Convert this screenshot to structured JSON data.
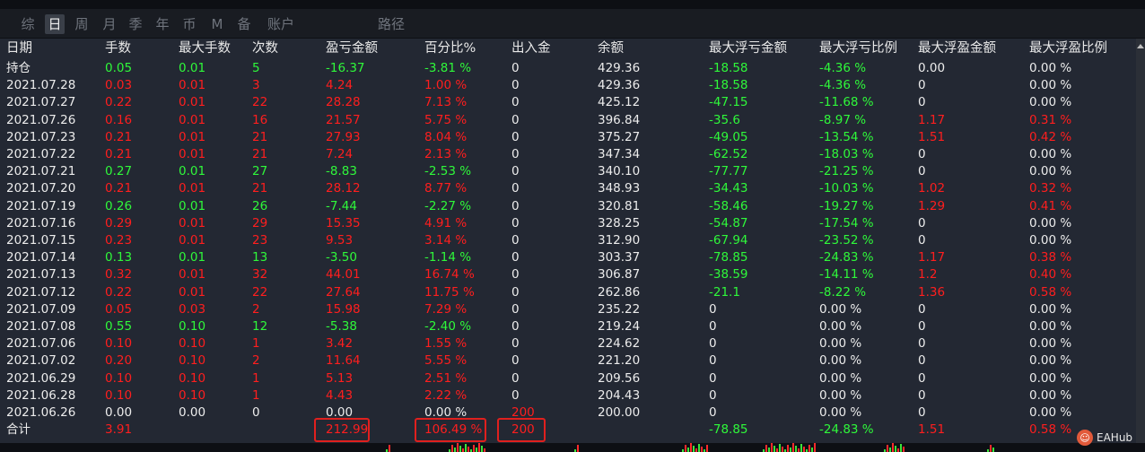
{
  "tabs": [
    {
      "label": "综",
      "active": false
    },
    {
      "label": "日",
      "active": true
    },
    {
      "label": "周",
      "active": false
    },
    {
      "label": "月",
      "active": false
    },
    {
      "label": "季",
      "active": false
    },
    {
      "label": "年",
      "active": false
    },
    {
      "label": "币",
      "active": false
    },
    {
      "label": "M",
      "active": false
    },
    {
      "label": "备",
      "active": false
    },
    {
      "label": "账户",
      "active": false
    },
    {
      "label": "路径",
      "active": false
    }
  ],
  "columns": [
    "日期",
    "手数",
    "最大手数",
    "次数",
    "盈亏金额",
    "百分比%",
    "出入金",
    "余额",
    "最大浮亏金额",
    "最大浮亏比例",
    "最大浮盈金额",
    "最大浮盈比例"
  ],
  "rows": [
    [
      "持仓",
      "0.05",
      "0.01",
      "5",
      "-16.37",
      "-3.81 %",
      "0",
      "429.36",
      "-18.58",
      "-4.36 %",
      "0.00",
      "0.00 %"
    ],
    [
      "2021.07.28",
      "0.03",
      "0.01",
      "3",
      "4.24",
      "1.00 %",
      "0",
      "429.36",
      "-18.58",
      "-4.36 %",
      "0",
      "0.00 %"
    ],
    [
      "2021.07.27",
      "0.22",
      "0.01",
      "22",
      "28.28",
      "7.13 %",
      "0",
      "425.12",
      "-47.15",
      "-11.68 %",
      "0",
      "0.00 %"
    ],
    [
      "2021.07.26",
      "0.16",
      "0.01",
      "16",
      "21.57",
      "5.75 %",
      "0",
      "396.84",
      "-35.6",
      "-8.97 %",
      "1.17",
      "0.31 %"
    ],
    [
      "2021.07.23",
      "0.21",
      "0.01",
      "21",
      "27.93",
      "8.04 %",
      "0",
      "375.27",
      "-49.05",
      "-13.54 %",
      "1.51",
      "0.42 %"
    ],
    [
      "2021.07.22",
      "0.21",
      "0.01",
      "21",
      "7.24",
      "2.13 %",
      "0",
      "347.34",
      "-62.52",
      "-18.03 %",
      "0",
      "0.00 %"
    ],
    [
      "2021.07.21",
      "0.27",
      "0.01",
      "27",
      "-8.83",
      "-2.53 %",
      "0",
      "340.10",
      "-77.77",
      "-21.25 %",
      "0",
      "0.00 %"
    ],
    [
      "2021.07.20",
      "0.21",
      "0.01",
      "21",
      "28.12",
      "8.77 %",
      "0",
      "348.93",
      "-34.43",
      "-10.03 %",
      "1.02",
      "0.32 %"
    ],
    [
      "2021.07.19",
      "0.26",
      "0.01",
      "26",
      "-7.44",
      "-2.27 %",
      "0",
      "320.81",
      "-58.46",
      "-19.27 %",
      "1.29",
      "0.41 %"
    ],
    [
      "2021.07.16",
      "0.29",
      "0.01",
      "29",
      "15.35",
      "4.91 %",
      "0",
      "328.25",
      "-54.87",
      "-17.54 %",
      "0",
      "0.00 %"
    ],
    [
      "2021.07.15",
      "0.23",
      "0.01",
      "23",
      "9.53",
      "3.14 %",
      "0",
      "312.90",
      "-67.94",
      "-23.52 %",
      "0",
      "0.00 %"
    ],
    [
      "2021.07.14",
      "0.13",
      "0.01",
      "13",
      "-3.50",
      "-1.14 %",
      "0",
      "303.37",
      "-78.85",
      "-24.83 %",
      "1.17",
      "0.38 %"
    ],
    [
      "2021.07.13",
      "0.32",
      "0.01",
      "32",
      "44.01",
      "16.74 %",
      "0",
      "306.87",
      "-38.59",
      "-14.11 %",
      "1.2",
      "0.40 %"
    ],
    [
      "2021.07.12",
      "0.22",
      "0.01",
      "22",
      "27.64",
      "11.75 %",
      "0",
      "262.86",
      "-21.1",
      "-8.22 %",
      "1.36",
      "0.58 %"
    ],
    [
      "2021.07.09",
      "0.05",
      "0.03",
      "2",
      "15.98",
      "7.29 %",
      "0",
      "235.22",
      "0",
      "0.00 %",
      "0",
      "0.00 %"
    ],
    [
      "2021.07.08",
      "0.55",
      "0.10",
      "12",
      "-5.38",
      "-2.40 %",
      "0",
      "219.24",
      "0",
      "0.00 %",
      "0",
      "0.00 %"
    ],
    [
      "2021.07.06",
      "0.10",
      "0.10",
      "1",
      "3.42",
      "1.55 %",
      "0",
      "224.62",
      "0",
      "0.00 %",
      "0",
      "0.00 %"
    ],
    [
      "2021.07.02",
      "0.20",
      "0.10",
      "2",
      "11.64",
      "5.55 %",
      "0",
      "221.20",
      "0",
      "0.00 %",
      "0",
      "0.00 %"
    ],
    [
      "2021.06.29",
      "0.10",
      "0.10",
      "1",
      "5.13",
      "2.51 %",
      "0",
      "209.56",
      "0",
      "0.00 %",
      "0",
      "0.00 %"
    ],
    [
      "2021.06.28",
      "0.10",
      "0.10",
      "1",
      "4.43",
      "2.22 %",
      "0",
      "204.43",
      "0",
      "0.00 %",
      "0",
      "0.00 %"
    ],
    [
      "2021.06.26",
      "0.00",
      "0.00",
      "0",
      "0.00",
      "0.00 %",
      "200",
      "200.00",
      "0",
      "0.00 %",
      "0",
      "0.00 %"
    ]
  ],
  "total": [
    "合计",
    "3.91",
    "",
    "",
    "212.99",
    "106.49 %",
    "200",
    "",
    "-78.85",
    "-24.83 %",
    "1.51",
    "0.58 %"
  ],
  "watermark": "EAHub",
  "colors": {
    "profit": "#ff1e1e",
    "loss": "#2ff83a",
    "neutral": "#ececec",
    "highlight": "#e0201e",
    "background": "#232833"
  }
}
